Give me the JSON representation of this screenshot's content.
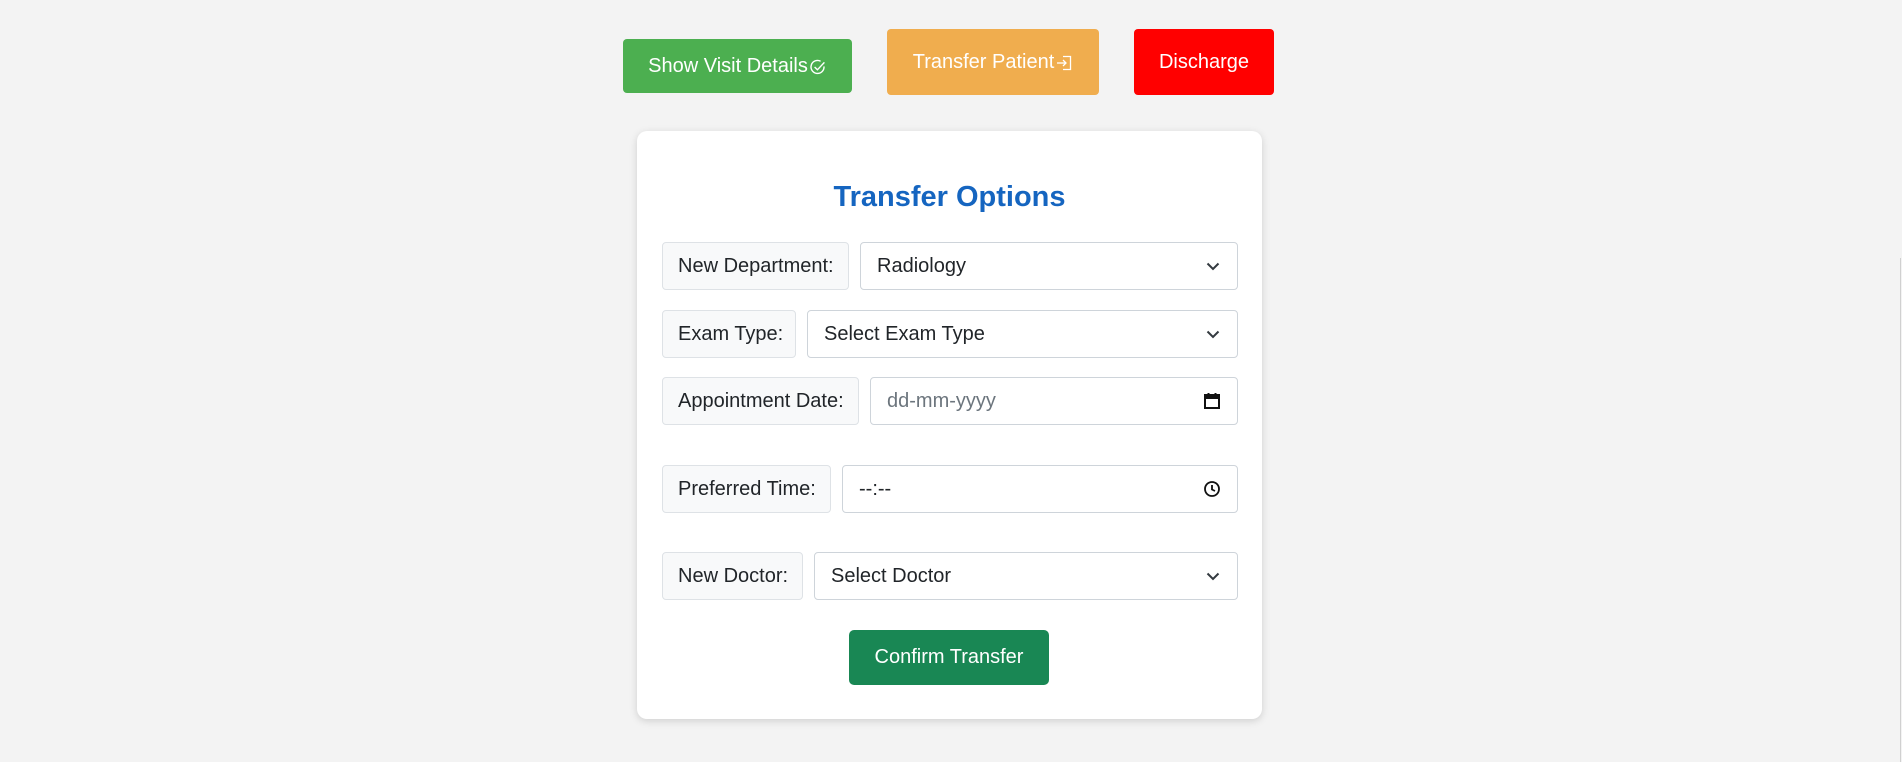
{
  "top_buttons": {
    "visit_label": "Show Visit Details",
    "transfer_label": "Transfer Patient",
    "discharge_label": "Discharge"
  },
  "colors": {
    "visit": "#4caf50",
    "transfer": "#f0ad4e",
    "discharge": "#ff0000",
    "confirm": "#198754",
    "title": "#1565c0"
  },
  "transfer_form": {
    "title": "Transfer Options",
    "department": {
      "label": "New Department:",
      "value": "Radiology"
    },
    "exam_type": {
      "label": "Exam Type:",
      "value": "Select Exam Type"
    },
    "appointment_date": {
      "label": "Appointment Date:",
      "placeholder": "dd-mm-yyyy"
    },
    "preferred_time": {
      "label": "Preferred Time:",
      "placeholder": "--:--"
    },
    "doctor": {
      "label": "New Doctor:",
      "value": "Select Doctor"
    },
    "confirm_label": "Confirm Transfer"
  },
  "icons": {
    "visit": "check-circle-icon",
    "transfer": "sign-in-icon",
    "select": "chevron-down-icon",
    "date": "calendar-icon",
    "time": "clock-icon"
  }
}
